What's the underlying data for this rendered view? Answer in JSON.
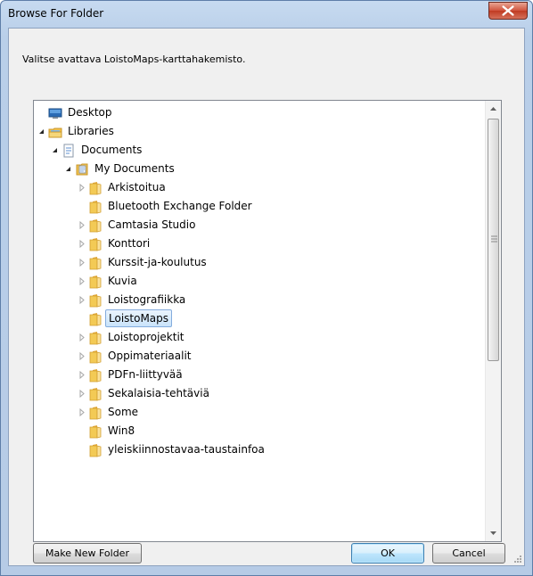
{
  "window": {
    "title": "Browse For Folder"
  },
  "instruction": "Valitse avattava LoistoMaps-karttahakemisto.",
  "tree": {
    "items": [
      {
        "label": "Desktop",
        "level": 0,
        "icon": "desktop-icon",
        "expander": "none",
        "selected": false
      },
      {
        "label": "Libraries",
        "level": 0,
        "icon": "libraries-icon",
        "expander": "expanded",
        "selected": false
      },
      {
        "label": "Documents",
        "level": 1,
        "icon": "documents-library-icon",
        "expander": "expanded",
        "selected": false
      },
      {
        "label": "My Documents",
        "level": 2,
        "icon": "my-documents-icon",
        "expander": "expanded",
        "selected": false
      },
      {
        "label": "Arkistoitua",
        "level": 3,
        "icon": "folder-icon",
        "expander": "collapsed",
        "selected": false
      },
      {
        "label": "Bluetooth Exchange Folder",
        "level": 3,
        "icon": "folder-icon",
        "expander": "none",
        "selected": false
      },
      {
        "label": "Camtasia Studio",
        "level": 3,
        "icon": "folder-icon",
        "expander": "collapsed",
        "selected": false
      },
      {
        "label": "Konttori",
        "level": 3,
        "icon": "folder-icon",
        "expander": "collapsed",
        "selected": false
      },
      {
        "label": "Kurssit-ja-koulutus",
        "level": 3,
        "icon": "folder-icon",
        "expander": "collapsed",
        "selected": false
      },
      {
        "label": "Kuvia",
        "level": 3,
        "icon": "folder-icon",
        "expander": "collapsed",
        "selected": false
      },
      {
        "label": "Loistografiikka",
        "level": 3,
        "icon": "folder-icon",
        "expander": "collapsed",
        "selected": false
      },
      {
        "label": "LoistoMaps",
        "level": 3,
        "icon": "folder-icon",
        "expander": "none",
        "selected": true
      },
      {
        "label": "Loistoprojektit",
        "level": 3,
        "icon": "folder-icon",
        "expander": "collapsed",
        "selected": false
      },
      {
        "label": "Oppimateriaalit",
        "level": 3,
        "icon": "folder-icon",
        "expander": "collapsed",
        "selected": false
      },
      {
        "label": "PDFn-liittyvää",
        "level": 3,
        "icon": "folder-icon",
        "expander": "collapsed",
        "selected": false
      },
      {
        "label": "Sekalaisia-tehtäviä",
        "level": 3,
        "icon": "folder-icon",
        "expander": "collapsed",
        "selected": false
      },
      {
        "label": "Some",
        "level": 3,
        "icon": "folder-icon",
        "expander": "collapsed",
        "selected": false
      },
      {
        "label": "Win8",
        "level": 3,
        "icon": "folder-icon",
        "expander": "none",
        "selected": false
      },
      {
        "label": "yleiskiinnostavaa-taustainfoa",
        "level": 3,
        "icon": "folder-icon",
        "expander": "none",
        "selected": false
      }
    ]
  },
  "buttons": {
    "make_new_folder": "Make New Folder",
    "ok": "OK",
    "cancel": "Cancel"
  },
  "colors": {
    "selection_fill": "#cce4f8",
    "selection_border": "#84acdd",
    "close_button": "#c9482f",
    "folder": "#f0c54e"
  }
}
